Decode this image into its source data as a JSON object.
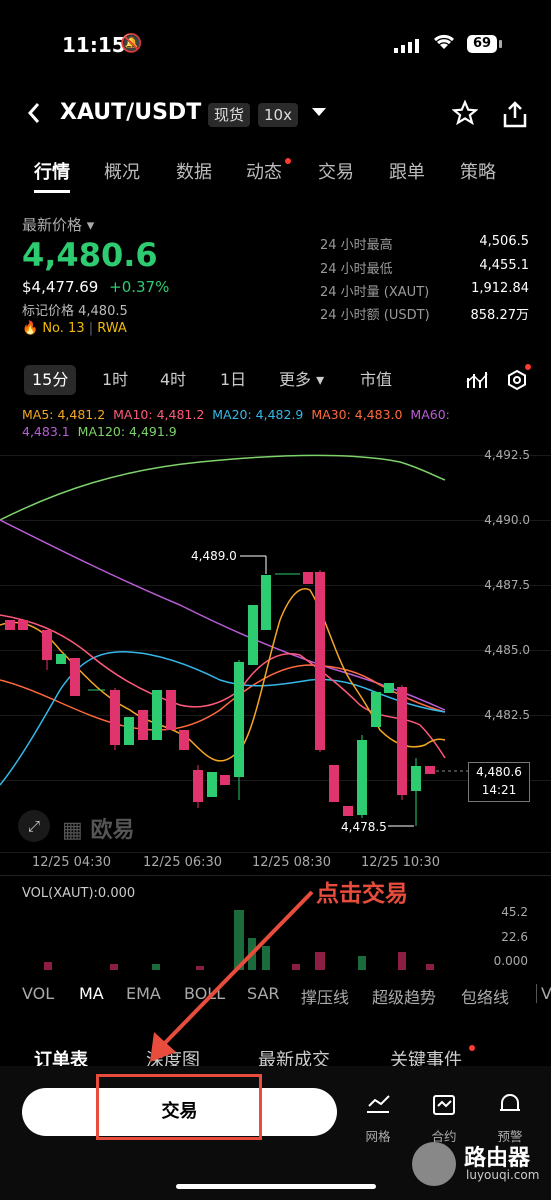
{
  "status_bar": {
    "time": "11:15",
    "battery": "69"
  },
  "header": {
    "pair": "XAUT/USDT",
    "market_type": "现货",
    "leverage": "10x"
  },
  "tabs": [
    "行情",
    "概况",
    "数据",
    "动态",
    "交易",
    "跟单",
    "策略"
  ],
  "price_panel": {
    "label": "最新价格",
    "price": "4,480.6",
    "usd_price": "$4,477.69",
    "change": "+0.37%",
    "mark_price": "标记价格 4,480.5",
    "rank": "No. 13",
    "tag": "RWA",
    "stats": [
      {
        "label": "24 小时最高",
        "value": "4,506.5"
      },
      {
        "label": "24 小时最低",
        "value": "4,455.1"
      },
      {
        "label": "24 小时量 (XAUT)",
        "value": "1,912.84"
      },
      {
        "label": "24 小时额 (USDT)",
        "value": "858.27万"
      }
    ]
  },
  "timeframes": [
    "15分",
    "1时",
    "4时",
    "1日",
    "更多",
    "市值"
  ],
  "ma_legend": {
    "ma5": "MA5: 4,481.2",
    "ma10": "MA10: 4,481.2",
    "ma20": "MA20: 4,482.9",
    "ma30": "MA30: 4,483.0",
    "ma60_label": "MA60:",
    "ma60_value": "4,483.1",
    "ma120": "MA120: 4,491.9"
  },
  "chart": {
    "y_ticks": [
      "4,492.5",
      "4,490.0",
      "4,487.5",
      "4,485.0",
      "4,482.5"
    ],
    "x_ticks": [
      "12/25 04:30",
      "12/25 06:30",
      "12/25 08:30",
      "12/25 10:30"
    ],
    "high_label": "4,489.0",
    "low_label": "4,478.5",
    "current_price": "4,480.6",
    "countdown": "14:21",
    "watermark": "欧易",
    "colors": {
      "up": "#2ecc71",
      "down": "#e0346e",
      "ma5": "#f5a623",
      "ma10": "#ff5a7a",
      "ma20": "#35b8e8",
      "ma30": "#ff6a3d",
      "ma60": "#b95cd6",
      "ma120": "#7ed36b"
    }
  },
  "volume": {
    "label": "VOL(XAUT):0.000",
    "ticks": [
      "45.2",
      "22.6",
      "0.000"
    ]
  },
  "indicators": [
    "VOL",
    "MA",
    "EMA",
    "BOLL",
    "SAR",
    "撑压线",
    "超级趋势",
    "包络线",
    "V"
  ],
  "bottom_tabs": [
    "订单表",
    "深度图",
    "最新成交",
    "关键事件"
  ],
  "footer": {
    "trade_label": "交易",
    "grid_label": "网格",
    "contract_label": "合约",
    "alert_label": "预警"
  },
  "annotation": "点击交易",
  "watermark_site": {
    "name": "路由器",
    "url": "luyouqi.com"
  }
}
